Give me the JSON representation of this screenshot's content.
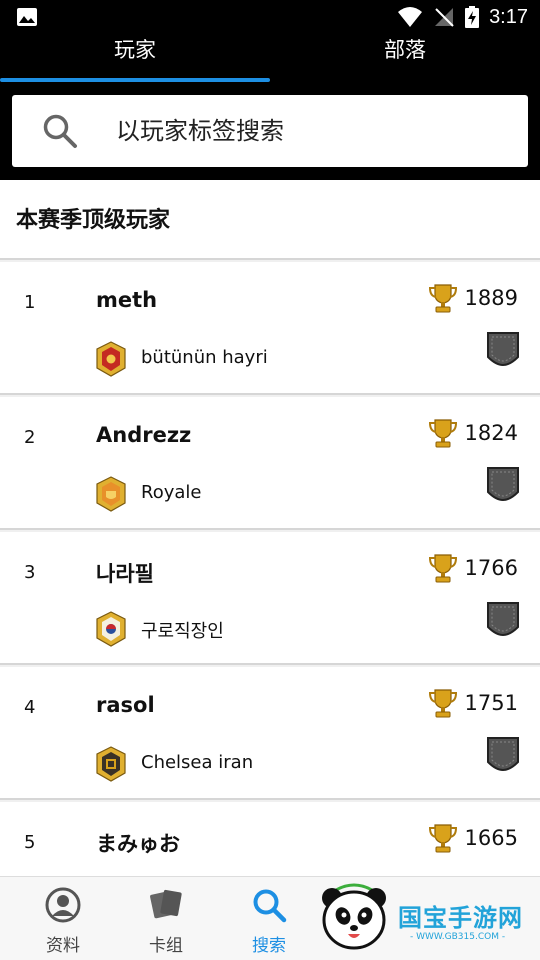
{
  "status_bar": {
    "time": "3:17"
  },
  "tabs": [
    {
      "label": "玩家",
      "active": true
    },
    {
      "label": "部落",
      "active": false
    }
  ],
  "search": {
    "placeholder": "以玩家标签搜索"
  },
  "section": {
    "title": "本赛季顶级玩家"
  },
  "players": [
    {
      "rank": "1",
      "name": "meth",
      "trophies": "1889",
      "clan": "bütünün hayri"
    },
    {
      "rank": "2",
      "name": "Andrezz",
      "trophies": "1824",
      "clan": "Royale"
    },
    {
      "rank": "3",
      "name": "나라필",
      "trophies": "1766",
      "clan": "구로직장인"
    },
    {
      "rank": "4",
      "name": "rasol",
      "trophies": "1751",
      "clan": "Chelsea iran"
    },
    {
      "rank": "5",
      "name": "まみゅお",
      "trophies": "1665",
      "clan": ""
    }
  ],
  "bottom_nav": [
    {
      "label": "资料",
      "icon": "profile-icon",
      "active": false
    },
    {
      "label": "卡组",
      "icon": "cards-icon",
      "active": false
    },
    {
      "label": "搜索",
      "icon": "search-icon",
      "active": true
    }
  ],
  "watermark": {
    "text": "国宝手游网",
    "sub": "- WWW.GB315.COM -"
  },
  "colors": {
    "accent": "#1d8fe3",
    "header_bg": "#000000",
    "trophy": "#d9a21b"
  }
}
